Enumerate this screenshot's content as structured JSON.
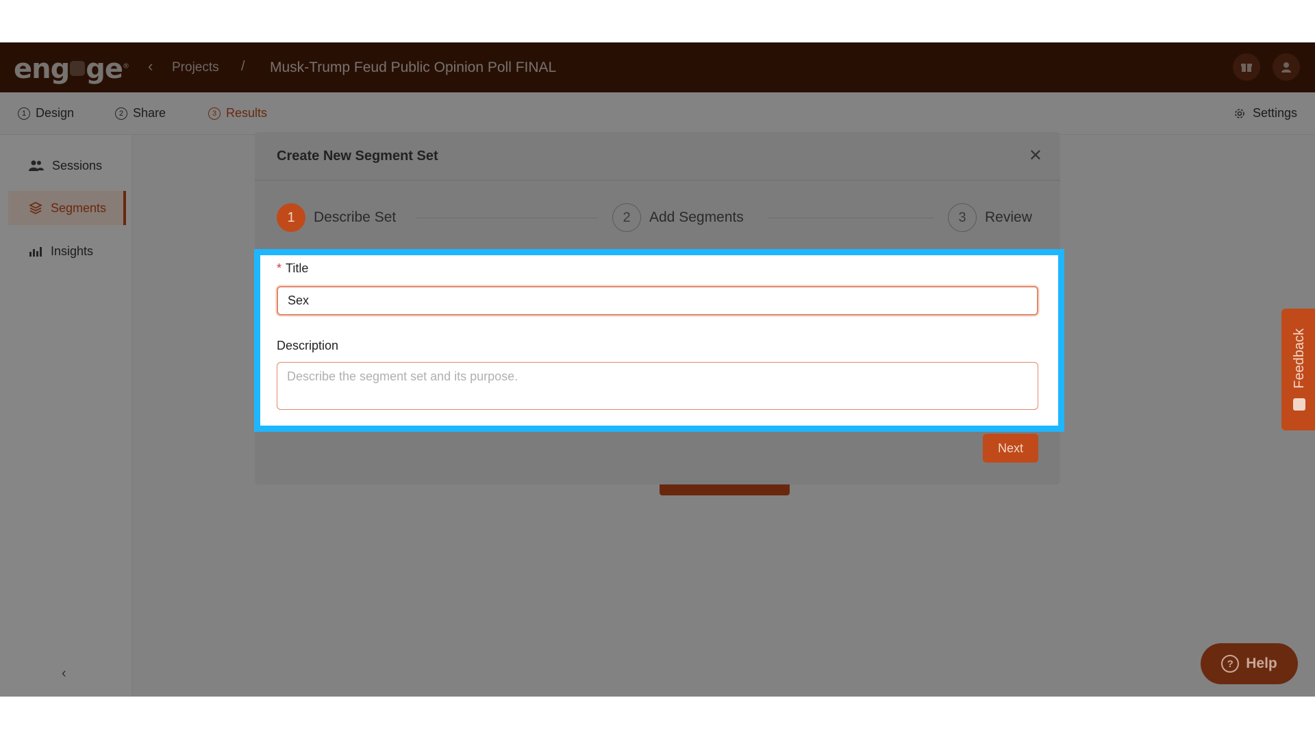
{
  "app": {
    "logo": "engage",
    "breadcrumb": {
      "projects": "Projects",
      "separator": "/",
      "current": "Musk-Trump Feud Public Opinion Poll FINAL"
    }
  },
  "nav": {
    "tabs": [
      {
        "num": "1",
        "label": "Design"
      },
      {
        "num": "2",
        "label": "Share"
      },
      {
        "num": "3",
        "label": "Results"
      }
    ],
    "settings": "Settings"
  },
  "sidebar": {
    "items": [
      {
        "label": "Sessions",
        "icon": "users-icon"
      },
      {
        "label": "Segments",
        "icon": "layers-icon"
      },
      {
        "label": "Insights",
        "icon": "chart-icon"
      }
    ]
  },
  "feedback": {
    "label": "Feedback"
  },
  "help": {
    "label": "Help"
  },
  "modal": {
    "title": "Create New Segment Set",
    "steps": [
      {
        "num": "1",
        "label": "Describe Set"
      },
      {
        "num": "2",
        "label": "Add Segments"
      },
      {
        "num": "3",
        "label": "Review"
      }
    ],
    "form": {
      "title_label": "Title",
      "required_mark": "*",
      "title_value": "Sex",
      "description_label": "Description",
      "description_placeholder": "Describe the segment set and its purpose."
    },
    "next_label": "Next"
  },
  "colors": {
    "brand": "#c04a1a",
    "highlight": "#1eb6ff",
    "header": "#4a1c08"
  }
}
